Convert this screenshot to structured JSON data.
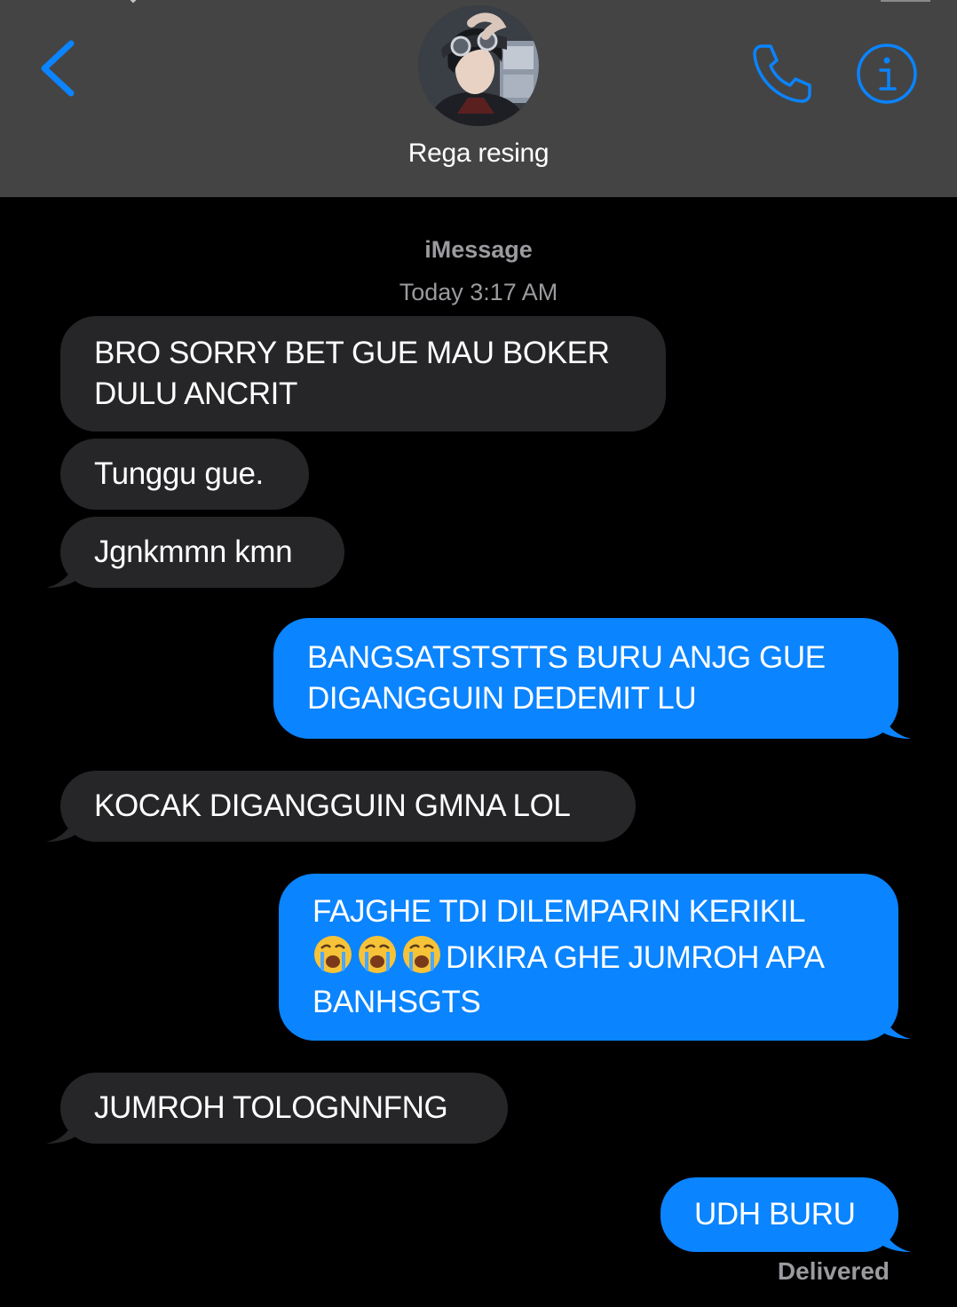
{
  "contact": {
    "name": "Rega resing"
  },
  "thread": {
    "service": "iMessage",
    "timestamp": "Today 3:17 AM",
    "delivered": "Delivered"
  },
  "colors": {
    "header_bg": "#444444",
    "incoming_bubble": "#262628",
    "outgoing_bubble": "#0a84ff",
    "accent": "#0a84ff",
    "meta_text": "#9a9a9f"
  },
  "icons": {
    "back": "chevron-left-icon",
    "call": "phone-icon",
    "info": "info-icon",
    "emoji": "loudly-crying-face-emoji"
  },
  "messages": [
    {
      "from": "them",
      "text": "BRO SORRY BET GUE MAU BOKER DULU ANCRIT"
    },
    {
      "from": "them",
      "text": "Tunggu gue."
    },
    {
      "from": "them",
      "text": "Jgnkmmn kmn"
    },
    {
      "from": "me",
      "text": "BANGSATSTSTTS BURU ANJG GUE DIGANGGUIN DEDEMIT LU"
    },
    {
      "from": "them",
      "text": "KOCAK DIGANGGUIN GMNA LOL"
    },
    {
      "from": "me",
      "text_before": "FAJGHE TDI DILEMPARIN KERIKIL",
      "emoji_count": 3,
      "text_after": "DIKIRA GHE JUMROH APA BANHSGTS"
    },
    {
      "from": "them",
      "text": "JUMROH TOLOGNNFNG"
    },
    {
      "from": "me",
      "text": "UDH BURU"
    }
  ]
}
